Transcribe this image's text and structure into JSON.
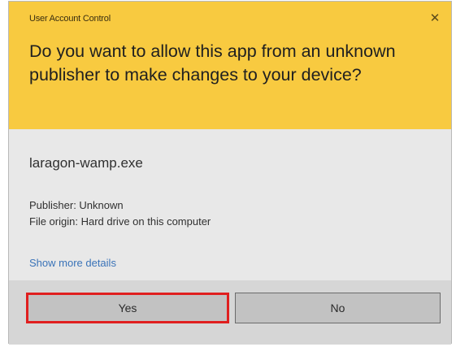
{
  "window": {
    "title": "User Account Control",
    "close_glyph": "✕"
  },
  "prompt": {
    "question": "Do you want to allow this app from an unknown publisher to make changes to your device?"
  },
  "app": {
    "name": "laragon-wamp.exe",
    "publisher": "Publisher: Unknown",
    "file_origin": "File origin: Hard drive on this computer"
  },
  "links": {
    "show_more": "Show more details"
  },
  "buttons": {
    "yes": "Yes",
    "no": "No"
  },
  "colors": {
    "header": "#f8ca40",
    "body": "#e8e8e8",
    "button_row": "#d6d6d6",
    "highlight": "#e01f1f",
    "link": "#3a73b8"
  },
  "icons": {
    "close": "close-icon"
  }
}
